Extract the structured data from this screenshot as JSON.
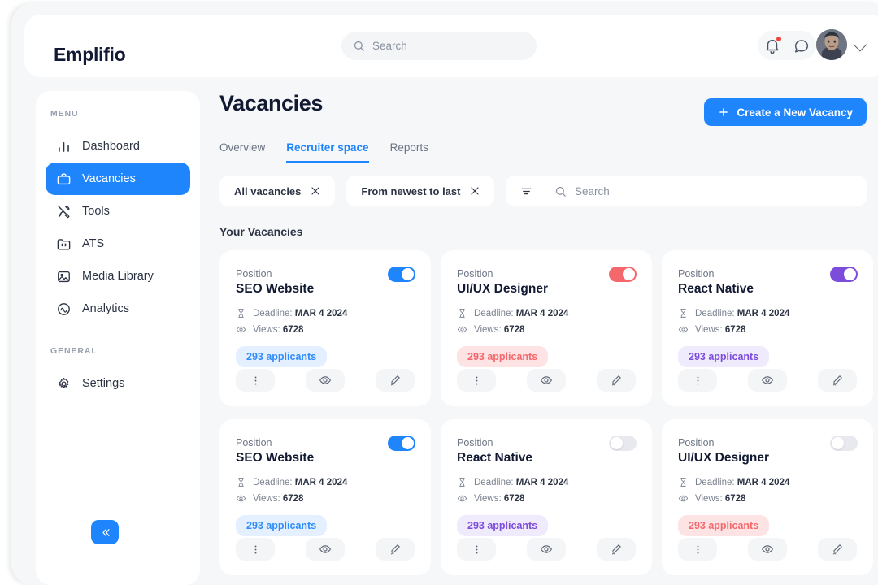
{
  "brand": {
    "logo": "Emplifio"
  },
  "topbar": {
    "search_placeholder": "Search",
    "notifications_icon": "bell-icon",
    "messages_icon": "chat-icon",
    "avatar_alt": "user-avatar",
    "chevron_icon": "chevron-down-icon"
  },
  "sidebar": {
    "menu_label": "MENU",
    "general_label": "GENERAL",
    "items": [
      {
        "label": "Dashboard",
        "icon": "bar-chart-icon",
        "active": false
      },
      {
        "label": "Vacancies",
        "icon": "briefcase-icon",
        "active": true
      },
      {
        "label": "Tools",
        "icon": "tools-icon",
        "active": false
      },
      {
        "label": "ATS",
        "icon": "folder-code-icon",
        "active": false
      },
      {
        "label": "Media Library",
        "icon": "image-icon",
        "active": false
      },
      {
        "label": "Analytics",
        "icon": "analytics-circle-icon",
        "active": false
      }
    ],
    "general_items": [
      {
        "label": "Settings",
        "icon": "gear-icon",
        "active": false
      }
    ],
    "collapse_icon": "double-chevron-left-icon"
  },
  "main": {
    "title": "Vacancies",
    "create_button": "Create a New Vacancy",
    "create_icon": "plus-icon",
    "tabs": [
      {
        "label": "Overview",
        "active": false
      },
      {
        "label": "Recruiter space",
        "active": true
      },
      {
        "label": "Reports",
        "active": false
      }
    ],
    "filters": [
      {
        "label": "All vacancies",
        "icon": "close-icon",
        "icon_side": "right"
      },
      {
        "label": "From newest to last",
        "icon": "close-icon",
        "icon_side": "right"
      },
      {
        "label": "More filters",
        "icon": "filter-lines-icon",
        "icon_side": "left"
      }
    ],
    "search_placeholder": "Search",
    "section_title": "Your Vacancies"
  },
  "colors": {
    "accent_blue": "#1f85fd",
    "badge_blue_bg": "#e4f0ff",
    "badge_blue_text": "#2f8dfb",
    "badge_red_bg": "#fde3e4",
    "badge_red_text": "#f4686c",
    "badge_purple_bg": "#efeafc",
    "badge_purple_text": "#7c4ddb",
    "toggle_blue": "#1f85fd",
    "toggle_red": "#f4686c",
    "toggle_purple": "#7c4ddb",
    "toggle_off": "#e7e9ee"
  },
  "card_labels": {
    "position": "Position",
    "deadline_prefix": "Deadline:",
    "views_prefix": "Views:",
    "deadline_icon": "hourglass-icon",
    "views_icon": "eye-icon",
    "more_icon": "vertical-dots-icon",
    "preview_icon": "eye-icon",
    "edit_icon": "pencil-icon"
  },
  "vacancies": [
    {
      "position_label": "Position",
      "title": "SEO Website",
      "deadline": "MAR 4 2024",
      "views": "6728",
      "applicants": "293 applicants",
      "toggle_on": true,
      "color": "blue"
    },
    {
      "position_label": "Position",
      "title": "UI/UX Designer",
      "deadline": "MAR 4 2024",
      "views": "6728",
      "applicants": "293 applicants",
      "toggle_on": true,
      "color": "red"
    },
    {
      "position_label": "Position",
      "title": "React Native",
      "deadline": "MAR 4 2024",
      "views": "6728",
      "applicants": "293 applicants",
      "toggle_on": true,
      "color": "purple"
    },
    {
      "position_label": "Position",
      "title": "SEO Website",
      "deadline": "MAR 4 2024",
      "views": "6728",
      "applicants": "293 applicants",
      "toggle_on": true,
      "color": "blue"
    },
    {
      "position_label": "Position",
      "title": "React Native",
      "deadline": "MAR 4 2024",
      "views": "6728",
      "applicants": "293 applicants",
      "toggle_on": false,
      "color": "purple"
    },
    {
      "position_label": "Position",
      "title": "UI/UX Designer",
      "deadline": "MAR 4 2024",
      "views": "6728",
      "applicants": "293 applicants",
      "toggle_on": false,
      "color": "red"
    }
  ]
}
